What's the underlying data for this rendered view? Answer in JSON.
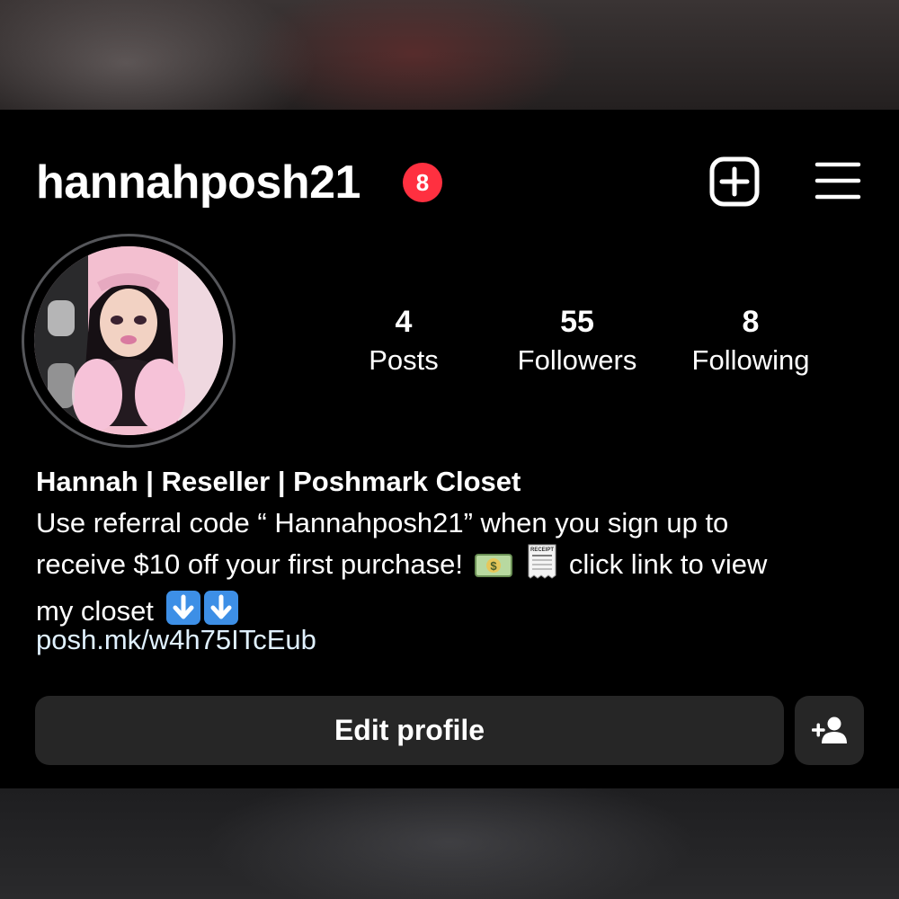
{
  "profile": {
    "username": "hannahposh21",
    "notification_count": "8"
  },
  "header": {
    "create_icon": "plus-square-icon",
    "menu_icon": "hamburger-menu-icon"
  },
  "stats": [
    {
      "value": "4",
      "label": "Posts"
    },
    {
      "value": "55",
      "label": "Followers"
    },
    {
      "value": "8",
      "label": "Following"
    }
  ],
  "bio": {
    "name": "Hannah | Reseller | Poshmark Closet",
    "line1": "Use referral code “ Hannahposh21” when you sign up to",
    "line2_a": "receive $10 off your first purchase!",
    "line2_b": "click link to view",
    "line3": "my closet",
    "emojis": [
      "money-bill-emoji",
      "receipt-emoji",
      "down-arrow-emoji",
      "down-arrow-emoji"
    ],
    "receipt_label": "RECEIPT",
    "link": "posh.mk/w4h75ITcEub"
  },
  "actions": {
    "edit_profile_label": "Edit profile",
    "add_user_icon": "add-person-icon"
  },
  "colors": {
    "badge": "#ff3040",
    "button_bg": "#262626",
    "link": "#e0f1ff"
  }
}
